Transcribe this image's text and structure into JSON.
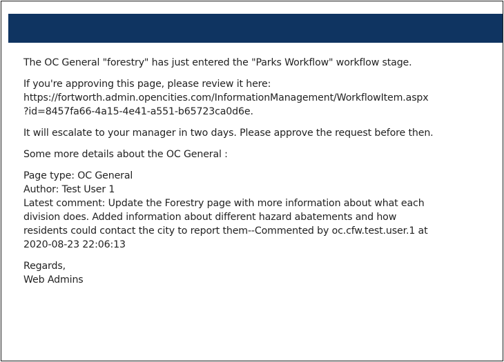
{
  "email": {
    "intro": "The OC General \"forestry\" has just entered the \"Parks Workflow\" workflow stage.",
    "review_prompt": "If you're approving this page, please review it here:",
    "review_link_line1": "https://fortworth.admin.opencities.com/InformationManagement/WorkflowItem.aspx",
    "review_link_line2": "?id=8457fa66-4a15-4e41-a551-b65723ca0d6e.",
    "escalation": "It will escalate to your manager in two days. Please approve the request before then.",
    "details_intro": "Some more details about the OC General :",
    "page_type": "Page type: OC General",
    "author": "Author: Test User 1",
    "comment_line1": "Latest comment: Update the Forestry page with more information about what each",
    "comment_line2": "division does. Added information about different hazard abatements and how",
    "comment_line3": "residents could contact the city to report them--Commented by oc.cfw.test.user.1 at",
    "comment_line4": "2020-08-23 22:06:13",
    "regards": "Regards,",
    "signature": "Web Admins"
  },
  "colors": {
    "header_bar": "#0f3461",
    "text": "#222222",
    "border": "#1a1a1a"
  }
}
